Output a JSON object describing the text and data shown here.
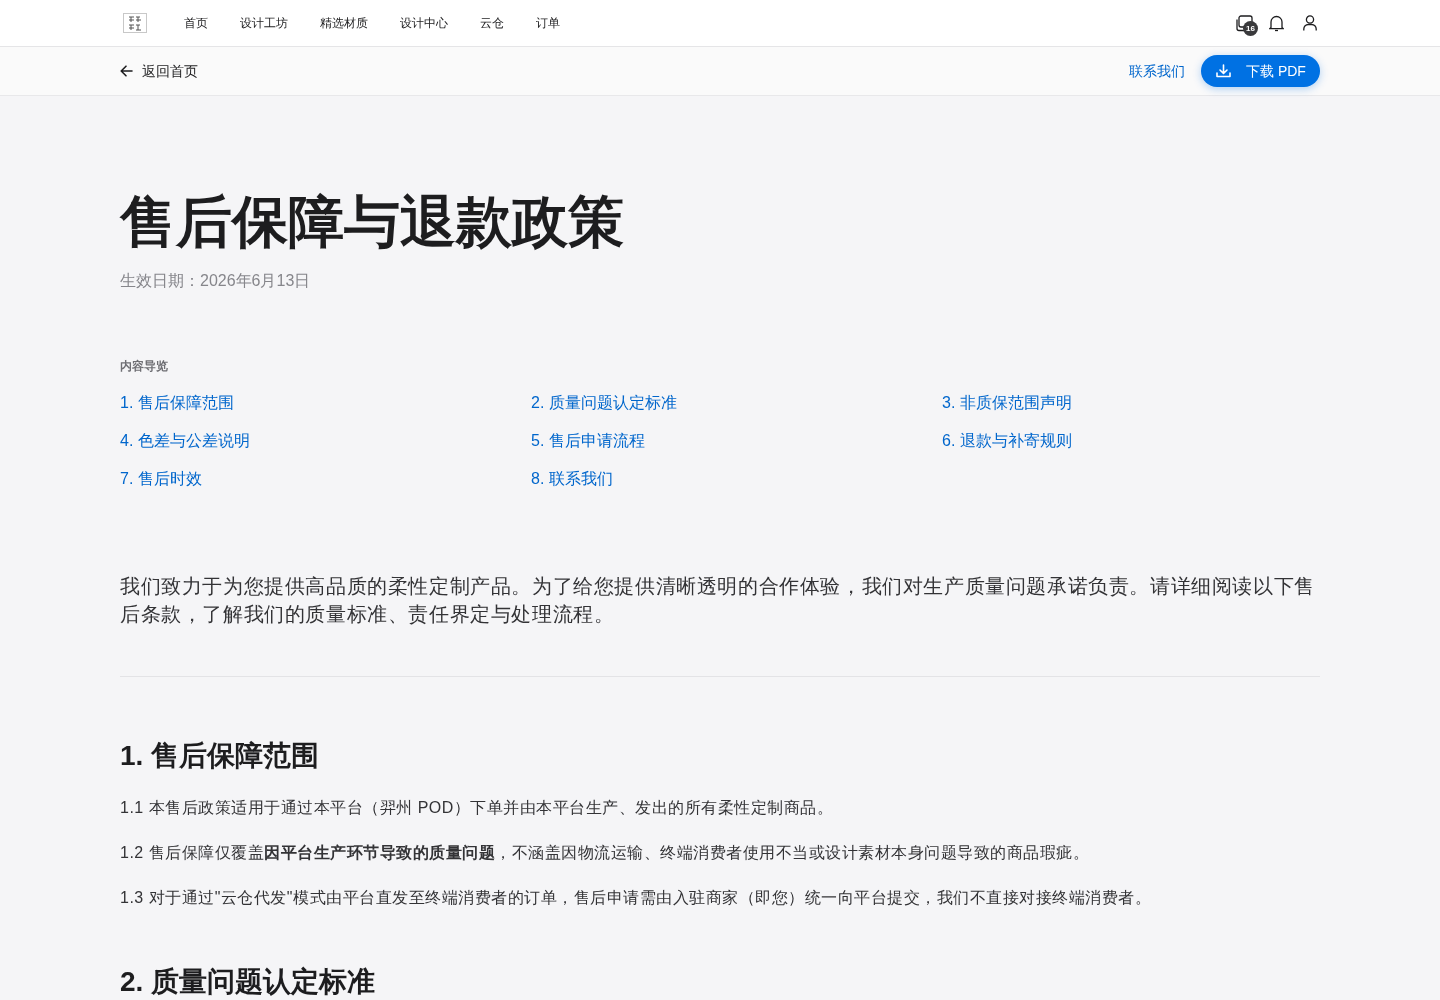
{
  "top_nav": {
    "items": [
      "首页",
      "设计工坊",
      "精选材质",
      "设计中心",
      "云仓",
      "订单"
    ],
    "badge_count": "16"
  },
  "sub_bar": {
    "back_link": "返回首页",
    "contact_link": "联系我们",
    "download_button": "下载 PDF"
  },
  "document": {
    "title": "售后保障与退款政策",
    "effective_date": "生效日期：2026年6月13日",
    "toc": {
      "heading": "内容导览",
      "items": [
        "1. 售后保障范围",
        "2. 质量问题认定标准",
        "3. 非质保范围声明",
        "4. 色差与公差说明",
        "5. 售后申请流程",
        "6. 退款与补寄规则",
        "7. 售后时效",
        "8. 联系我们"
      ]
    },
    "intro": "我们致力于为您提供高品质的柔性定制产品。为了给您提供清晰透明的合作体验，我们对生产质量问题承诺负责。请详细阅读以下售后条款，了解我们的质量标准、责任界定与处理流程。",
    "sections": [
      {
        "heading": "1. 售后保障范围",
        "paragraphs": [
          "1.1 本售后政策适用于通过本平台（羿州 POD）下单并由本平台生产、发出的所有柔性定制商品。",
          "1.2 售后保障仅覆盖**因平台生产环节导致的质量问题**，不涵盖因物流运输、终端消费者使用不当或设计素材本身问题导致的商品瑕疵。",
          "1.3 对于通过\"云仓代发\"模式由平台直发至终端消费者的订单，售后申请需由入驻商家（即您）统一向平台提交，我们不直接对接终端消费者。"
        ]
      },
      {
        "heading": "2. 质量问题认定标准"
      }
    ]
  }
}
